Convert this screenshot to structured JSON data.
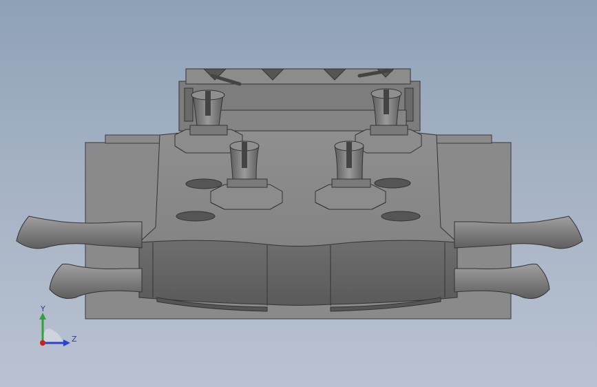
{
  "viewport": {
    "background_top": "#8fa1b8",
    "background_bottom": "#b9c2d1",
    "model_color": "#8c8c8c"
  },
  "triad": {
    "y_label": "Y",
    "z_label": "Z",
    "y_color": "#2fa33a",
    "z_color": "#2b3fd1",
    "x_color": "#cc1f1f"
  }
}
